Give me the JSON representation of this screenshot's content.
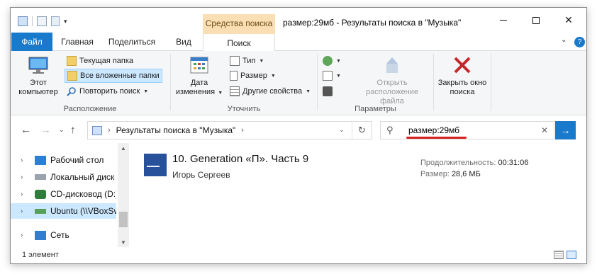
{
  "window": {
    "context_tab": "Средства поиска",
    "title": "размер:29мб - Результаты поиска в \"Музыка\""
  },
  "tabs": {
    "file": "Файл",
    "home": "Главная",
    "share": "Поделиться",
    "view": "Вид",
    "search": "Поиск"
  },
  "ribbon": {
    "location": {
      "label": "Расположение",
      "this_pc": "Этот компьютер",
      "current_folder": "Текущая папка",
      "all_subfolders": "Все вложенные папки",
      "search_again": "Повторить поиск"
    },
    "refine": {
      "label": "Уточнить",
      "date_modified": "Дата изменения",
      "kind": "Тип",
      "size": "Размер",
      "other_properties": "Другие свойства"
    },
    "options": {
      "label": "Параметры",
      "open_file_location": "Открыть расположение файла"
    },
    "close": {
      "close_search": "Закрыть окно поиска"
    }
  },
  "address": {
    "path": "Результаты поиска в \"Музыка\""
  },
  "search": {
    "value": "размер:29мб"
  },
  "tree": {
    "items": [
      {
        "label": "Рабочий стол",
        "icon": "desktop-icon"
      },
      {
        "label": "Локальный диск",
        "icon": "local-disk-icon"
      },
      {
        "label": "CD-дисковод (D:)",
        "icon": "cd-drive-icon"
      },
      {
        "label": "Ubuntu (\\\\VBoxSv",
        "icon": "network-drive-icon"
      },
      {
        "label": "Сеть",
        "icon": "network-icon"
      }
    ]
  },
  "results": [
    {
      "title": "10. Generation «П». Часть 9",
      "author": "Игорь Сергеев",
      "duration_label": "Продолжительность:",
      "duration": "00:31:06",
      "size_label": "Размер:",
      "size": "28,6 МБ"
    }
  ],
  "status": {
    "count": "1 элемент"
  },
  "colors": {
    "accent": "#1979ca",
    "context_tab": "#fadfb4",
    "underline": "#d61f1f"
  }
}
